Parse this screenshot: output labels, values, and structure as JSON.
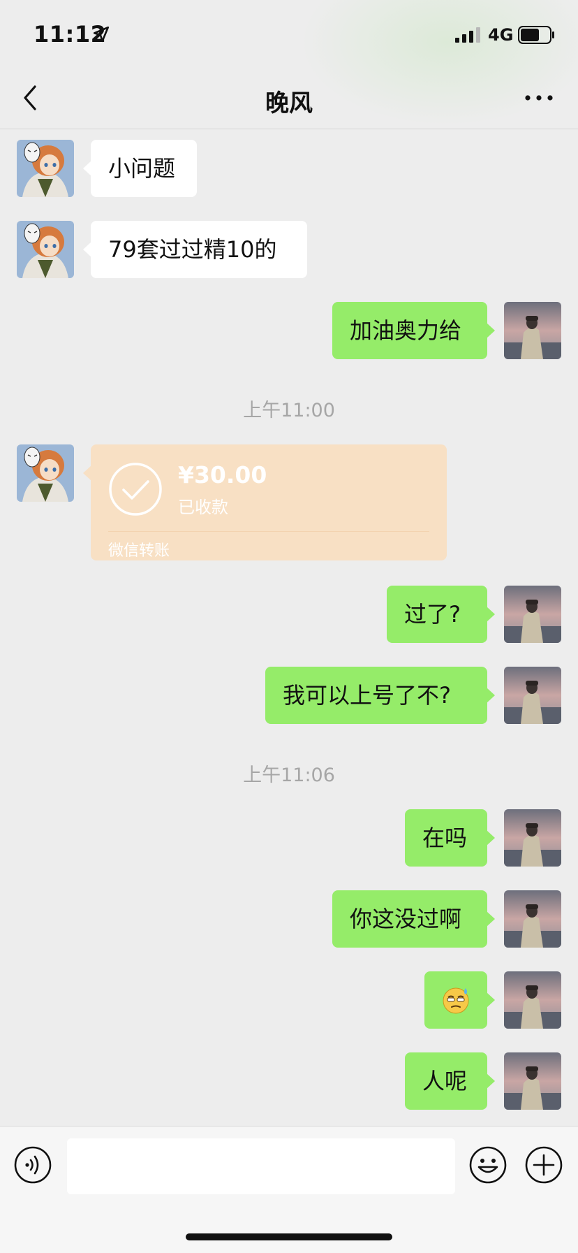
{
  "status_bar": {
    "time": "11:12",
    "network": "4G",
    "location_icon": "location-arrow-icon",
    "signal_icon": "cellular-signal-icon",
    "battery_icon": "battery-icon"
  },
  "nav": {
    "title": "晚风",
    "back_icon": "chevron-left-icon",
    "more_icon": "more-dots-icon"
  },
  "messages": [
    {
      "side": "left",
      "text": "小问题"
    },
    {
      "side": "left",
      "text": "79套过过精10的"
    },
    {
      "side": "right",
      "text": "加油奥力给"
    },
    {
      "side": "right",
      "text": "过了?"
    },
    {
      "side": "right",
      "text": "我可以上号了不?"
    },
    {
      "side": "right",
      "text": "在吗"
    },
    {
      "side": "right",
      "text": "你这没过啊"
    },
    {
      "side": "right",
      "text": "",
      "emoji": "sweat-face-emoji"
    },
    {
      "side": "right",
      "text": "人呢"
    }
  ],
  "timestamps": [
    "上午11:00",
    "上午11:06"
  ],
  "transfer": {
    "amount": "¥30.00",
    "status": "已收款",
    "label": "微信转账",
    "icon": "check-circle-icon"
  },
  "input_bar": {
    "voice_icon": "voice-icon",
    "emoji_icon": "smiley-icon",
    "plus_icon": "plus-circle-icon",
    "input_value": ""
  },
  "colors": {
    "background": "#ededed",
    "sent_bubble": "#95ec69",
    "received_bubble": "#ffffff",
    "transfer_card": "#f8e0c4",
    "timestamp_text": "#a6a6a6"
  }
}
